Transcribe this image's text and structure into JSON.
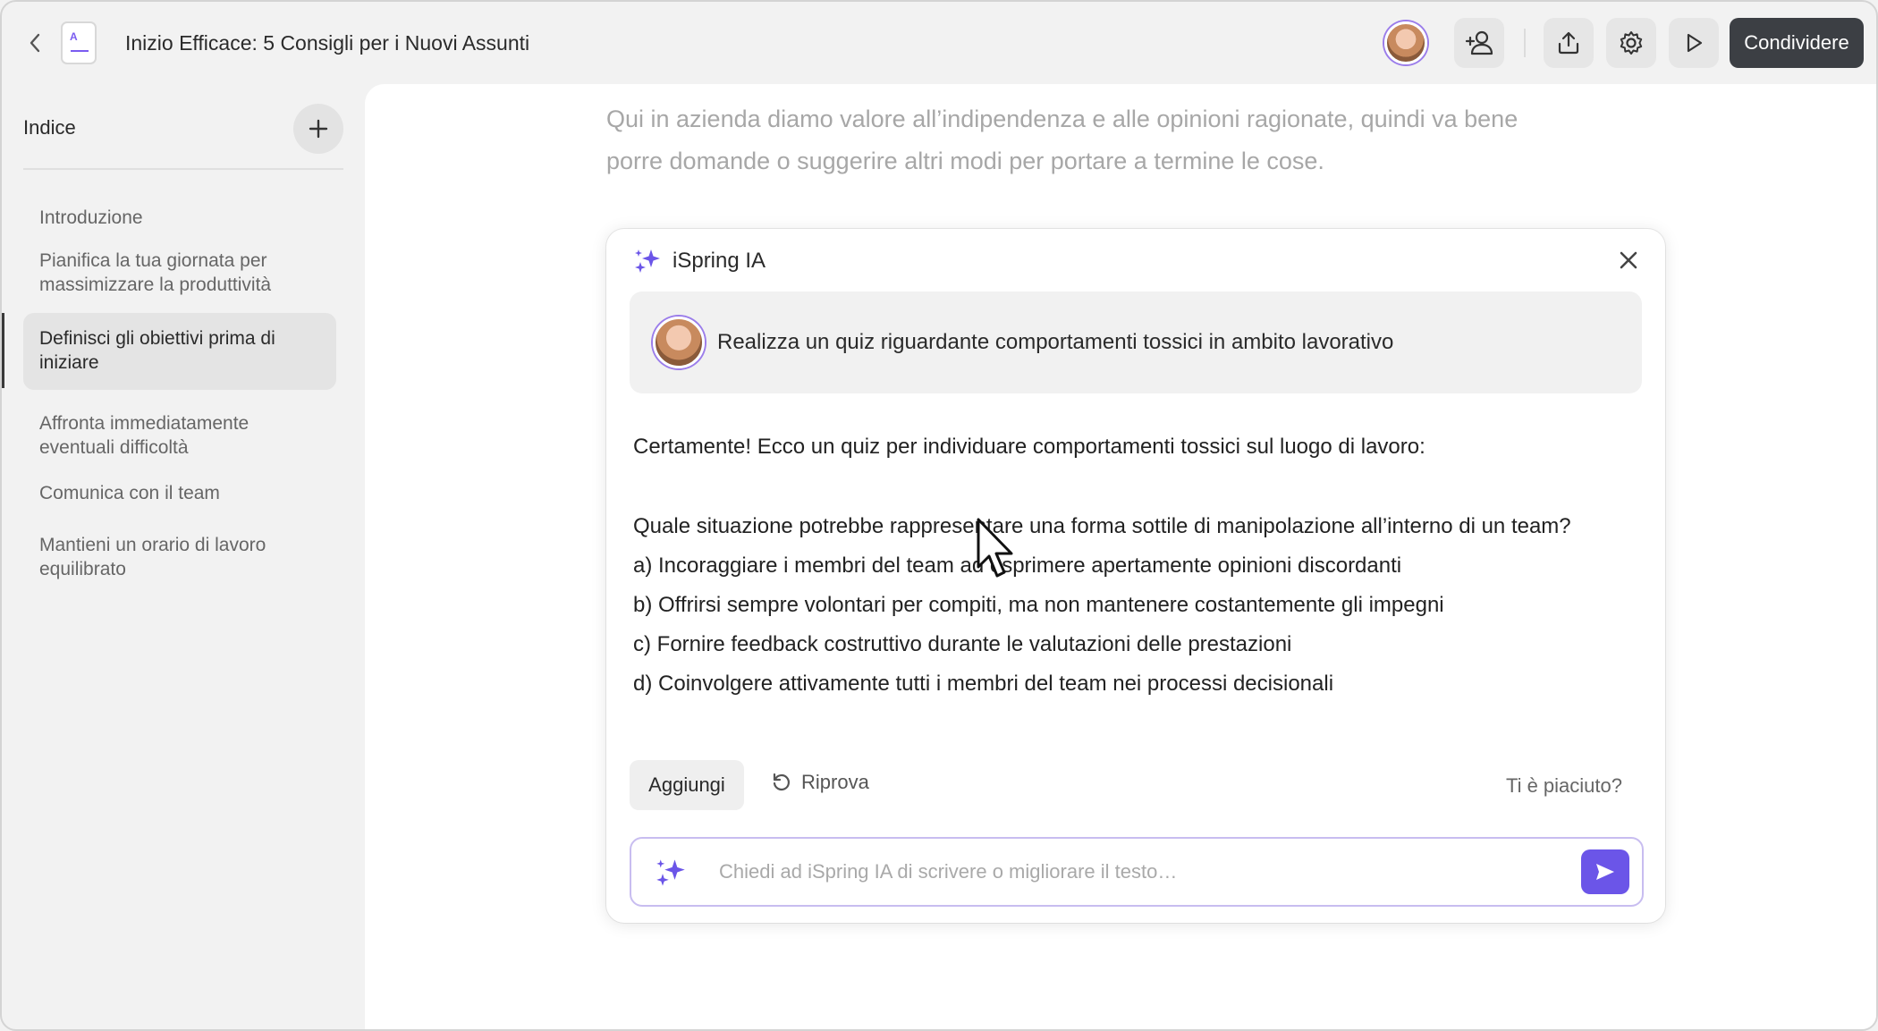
{
  "header": {
    "back_icon": "chevron-left-icon",
    "doc_icon_letter": "A",
    "title": "Inizio Efficace: 5 Consigli per i Nuovi Assunti",
    "share_label": "Condividere"
  },
  "sidebar": {
    "title": "Indice",
    "items": [
      {
        "label": "Introduzione"
      },
      {
        "label": "Pianifica la tua giornata per massimizzare la produttività"
      },
      {
        "label": "Definisci gli obiettivi prima di iniziare",
        "active": true
      },
      {
        "label": "Affronta immediatamente eventuali difficoltà"
      },
      {
        "label": "Comunica con il team"
      },
      {
        "label": "Mantieni un orario di lavoro equilibrato"
      }
    ]
  },
  "main": {
    "intro_text": "Qui in azienda diamo valore all’indipendenza e alle opinioni ragionate, quindi va bene porre domande o suggerire altri modi per portare a termine le cose."
  },
  "ai_panel": {
    "name": "iSpring IA",
    "prompt": "Realizza un quiz riguardante comportamenti tossici in ambito lavorativo",
    "answer_intro": "Certamente! Ecco un quiz per individuare comportamenti tossici sul luogo di lavoro:",
    "question": "Quale situazione potrebbe rappresentare una forma sottile di manipolazione all’interno di un team?",
    "options": [
      "a) Incoraggiare i membri del team ad esprimere apertamente opinioni discordanti",
      "b) Offrirsi sempre volontari per compiti, ma non mantenere costantemente gli impegni",
      "c) Fornire feedback costruttivo durante le valutazioni delle prestazioni",
      "d) Coinvolgere attivamente tutti i membri del team nei processi decisionali"
    ],
    "add_label": "Aggiungi",
    "retry_label": "Riprova",
    "feedback_label": "Ti è piaciuto?",
    "input_placeholder": "Chiedi ad iSpring IA di scrivere o migliorare il testo…",
    "input_value": ""
  },
  "colors": {
    "accent": "#6b55e8",
    "share_bg": "#3c3f44",
    "sparkle": "#6b55e8"
  }
}
